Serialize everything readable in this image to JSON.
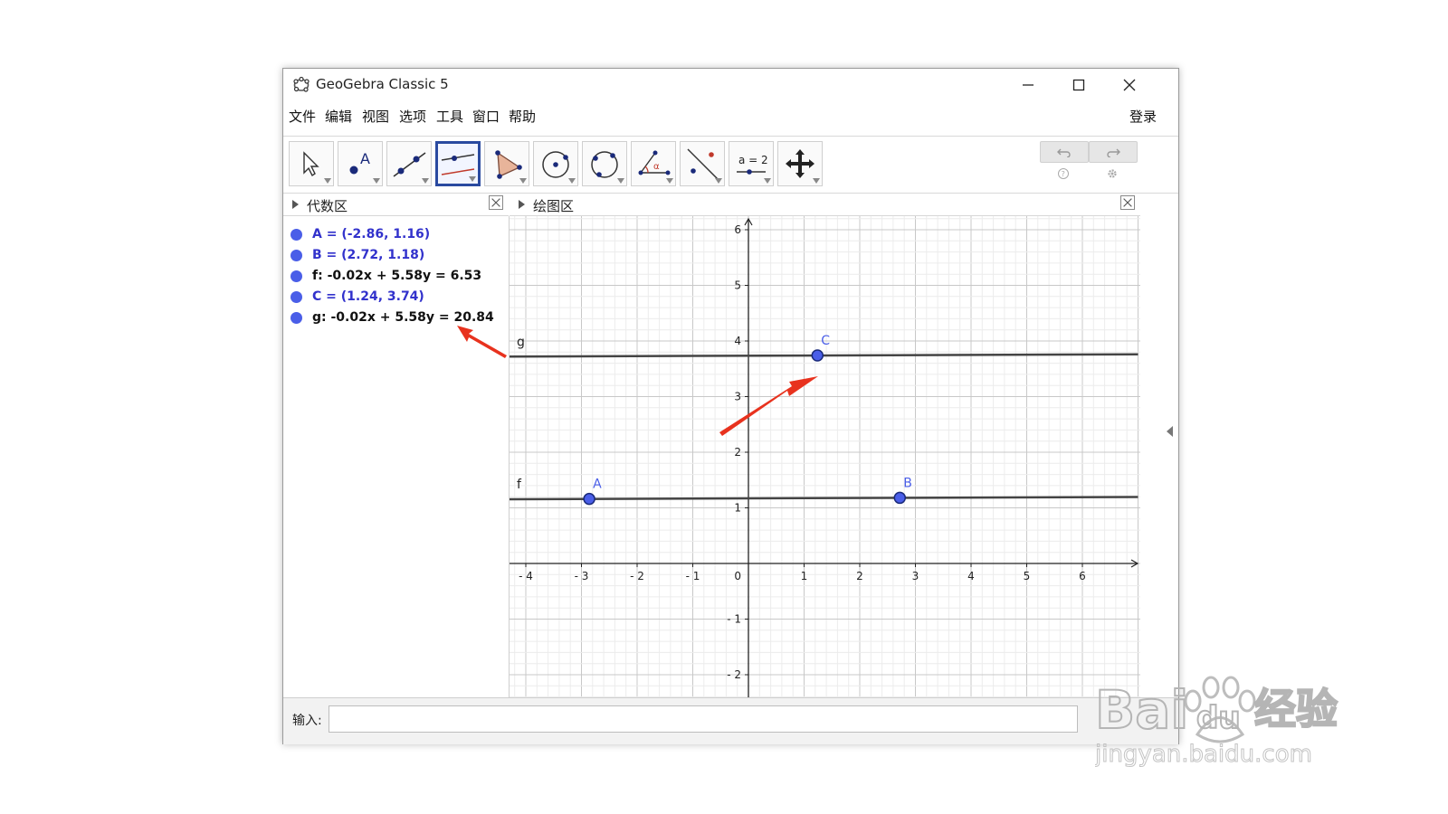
{
  "window": {
    "title": "GeoGebra Classic 5",
    "minimize_icon": "minimize-icon",
    "maximize_icon": "maximize-icon",
    "close_icon": "close-icon"
  },
  "menu": {
    "items": [
      "文件",
      "编辑",
      "视图",
      "选项",
      "工具",
      "窗口",
      "帮助"
    ],
    "login": "登录"
  },
  "toolbar": {
    "tools": [
      "move-icon",
      "point-icon",
      "line-icon",
      "parallel-line-icon",
      "polygon-icon",
      "circle-center-icon",
      "circle-three-points-icon",
      "angle-icon",
      "reflect-icon",
      "slider-icon",
      "move-view-icon"
    ],
    "active_tool": "parallel-line-icon",
    "slider_label": "a = 2",
    "angle_label": "α"
  },
  "algebra": {
    "title": "代数区",
    "items": [
      {
        "text": "A = (-2.86, 1.16)",
        "color": "#3232cc"
      },
      {
        "text": "B = (2.72, 1.18)",
        "color": "#3232cc"
      },
      {
        "text": "f: -0.02x + 5.58y = 6.53",
        "color": "#111111"
      },
      {
        "text": "C = (1.24, 3.74)",
        "color": "#3232cc"
      },
      {
        "text": "g: -0.02x + 5.58y = 20.84",
        "color": "#111111"
      }
    ]
  },
  "graphics": {
    "title": "绘图区",
    "x_ticks": [
      -4,
      -3,
      -2,
      -1,
      1,
      2,
      3,
      4,
      5,
      6
    ],
    "y_ticks": [
      -2,
      -1,
      1,
      2,
      3,
      4,
      5,
      6
    ],
    "origin_label": "0",
    "points": [
      {
        "name": "A",
        "x": -2.86,
        "y": 1.16
      },
      {
        "name": "B",
        "x": 2.72,
        "y": 1.18
      },
      {
        "name": "C",
        "x": 1.24,
        "y": 3.74
      }
    ],
    "lines": [
      {
        "name": "f",
        "a": -0.02,
        "b": 5.58,
        "c": 6.53
      },
      {
        "name": "g",
        "a": -0.02,
        "b": 5.58,
        "c": 20.84
      }
    ],
    "point_color": "#4a5ee8",
    "label_color": "#4a5ee8"
  },
  "input": {
    "label": "输入:"
  },
  "watermark": {
    "brand": "Bai",
    "brand_suffix": "du",
    "cn": "经验",
    "url": "jingyan.baidu.com"
  },
  "annotation_color": "#e8321e"
}
